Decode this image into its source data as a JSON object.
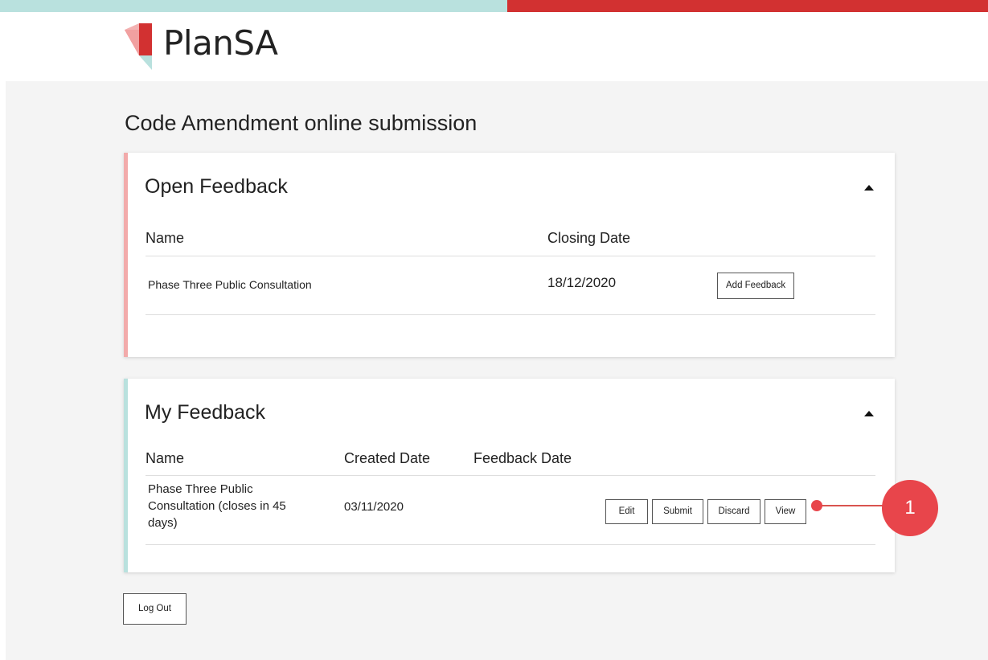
{
  "brand": {
    "name": "PlanSA",
    "colors": {
      "teal": "#b9e1de",
      "red": "#d23131",
      "pink": "#f2aaaa"
    }
  },
  "page": {
    "title": "Code Amendment online submission"
  },
  "open_feedback": {
    "title": "Open Feedback",
    "columns": {
      "name": "Name",
      "closing_date": "Closing Date"
    },
    "rows": [
      {
        "name": "Phase Three Public Consultation",
        "closing_date": "18/12/2020",
        "action_label": "Add Feedback"
      }
    ]
  },
  "my_feedback": {
    "title": "My Feedback",
    "columns": {
      "name": "Name",
      "created_date": "Created Date",
      "feedback_date": "Feedback Date"
    },
    "rows": [
      {
        "name_line1": "Phase Three Public",
        "name_line2": "Consultation (closes in 45",
        "name_line3": "days)",
        "created_date": "03/11/2020",
        "feedback_date": "",
        "actions": {
          "edit": "Edit",
          "submit": "Submit",
          "discard": "Discard",
          "view": "View"
        }
      }
    ]
  },
  "logout_label": "Log Out",
  "callout": {
    "number": "1"
  },
  "icons": {
    "collapse": "caret-up-icon",
    "logo": "plansa-logo-icon"
  }
}
